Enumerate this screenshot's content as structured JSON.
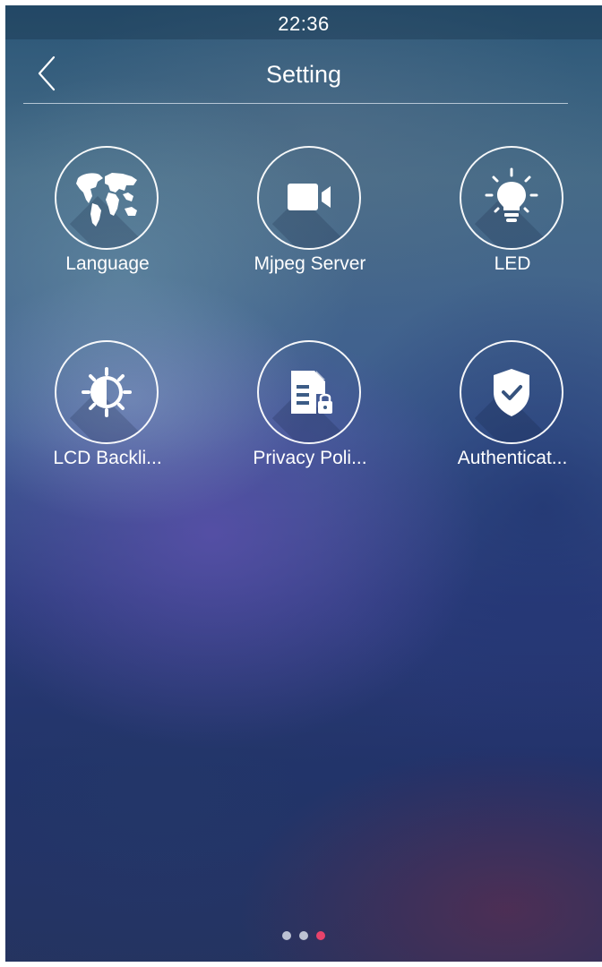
{
  "status_bar": {
    "time": "22:36"
  },
  "header": {
    "title": "Setting",
    "back_icon": "chevron-left-icon"
  },
  "tiles": [
    {
      "label": "Language",
      "icon": "world-map-icon"
    },
    {
      "label": "Mjpeg Server",
      "icon": "video-camera-icon"
    },
    {
      "label": "LED",
      "icon": "light-bulb-icon"
    },
    {
      "label": "LCD Backli...",
      "icon": "brightness-icon"
    },
    {
      "label": "Privacy Poli...",
      "icon": "document-lock-icon"
    },
    {
      "label": "Authenticat...",
      "icon": "shield-check-icon"
    }
  ],
  "pagination": {
    "pages": 3,
    "active_page": 3
  },
  "colors": {
    "accent_dot": "#e8436b",
    "icon": "#ffffff"
  }
}
